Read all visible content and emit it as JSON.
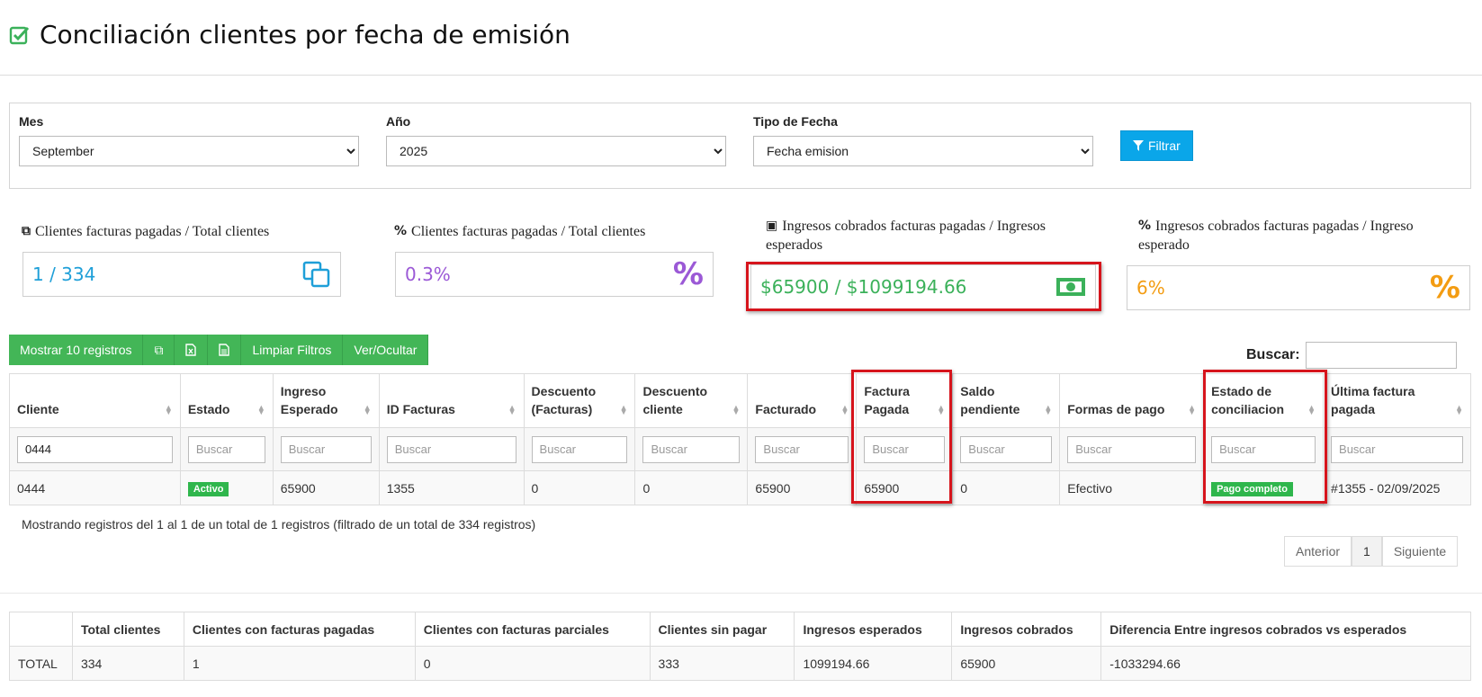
{
  "page": {
    "title": "Conciliación clientes por fecha de emisión"
  },
  "filters": {
    "month_label": "Mes",
    "month_value": "September",
    "year_label": "Año",
    "year_value": "2025",
    "date_type_label": "Tipo de Fecha",
    "date_type_value": "Fecha emision",
    "filter_button": "Filtrar"
  },
  "stats": [
    {
      "label": "Clientes facturas pagadas / Total clientes",
      "value": "1 / 334",
      "icon": "copy-icon",
      "color": "#1e9fd8"
    },
    {
      "label": "Clientes facturas pagadas / Total clientes",
      "value": "0.3%",
      "icon": "percent-icon",
      "color": "#9b59d6"
    },
    {
      "label_line1": "Ingresos cobrados facturas pagadas / Ingresos",
      "label_line2": "esperados",
      "value": "$65900 / $1099194.66",
      "icon": "money-icon",
      "color": "#3bb15a"
    },
    {
      "label_line1": "Ingresos cobrados facturas pagadas / Ingreso",
      "label_line2": "esperado",
      "value": "6%",
      "icon": "percent-icon",
      "color": "#f39c12"
    }
  ],
  "toolbar": {
    "show_records": "Mostrar 10 registros",
    "clear_filters": "Limpiar Filtros",
    "toggle_columns": "Ver/Ocultar"
  },
  "search": {
    "label": "Buscar:"
  },
  "table": {
    "headers": [
      {
        "l1": "",
        "l2": "Cliente"
      },
      {
        "l1": "",
        "l2": "Estado"
      },
      {
        "l1": "Ingreso",
        "l2": "Esperado"
      },
      {
        "l1": "",
        "l2": "ID Facturas"
      },
      {
        "l1": "Descuento",
        "l2": "(Facturas)"
      },
      {
        "l1": "Descuento",
        "l2": "cliente"
      },
      {
        "l1": "",
        "l2": "Facturado"
      },
      {
        "l1": "Factura",
        "l2": "Pagada"
      },
      {
        "l1": "Saldo",
        "l2": "pendiente"
      },
      {
        "l1": "",
        "l2": "Formas de pago"
      },
      {
        "l1": "Estado de",
        "l2": "conciliacion"
      },
      {
        "l1": "Última factura",
        "l2": "pagada"
      }
    ],
    "filter_placeholder": "Buscar",
    "filter_cliente_value": "0444",
    "row": {
      "cliente": "0444",
      "estado": "Activo",
      "ingreso_esperado": "65900",
      "id_facturas": "1355",
      "descuento_facturas": "0",
      "descuento_cliente": "0",
      "facturado": "65900",
      "factura_pagada": "65900",
      "saldo_pendiente": "0",
      "formas_pago": "Efectivo",
      "estado_conciliacion": "Pago completo",
      "ultima_factura": "#1355 - 02/09/2025"
    }
  },
  "info_text": "Mostrando registros del 1 al 1 de un total de 1 registros (filtrado de un total de 334 registros)",
  "pagination": {
    "prev": "Anterior",
    "page": "1",
    "next": "Siguiente"
  },
  "summary": {
    "headers": [
      "",
      "Total clientes",
      "Clientes con facturas pagadas",
      "Clientes con facturas parciales",
      "Clientes sin pagar",
      "Ingresos esperados",
      "Ingresos cobrados",
      "Diferencia Entre ingresos cobrados vs esperados"
    ],
    "row": [
      "TOTAL",
      "334",
      "1",
      "0",
      "333",
      "1099194.66",
      "65900",
      "-1033294.66"
    ]
  },
  "colors": {
    "green": "#43b657",
    "blue": "#0aa6e9",
    "highlight": "#d6141c"
  }
}
